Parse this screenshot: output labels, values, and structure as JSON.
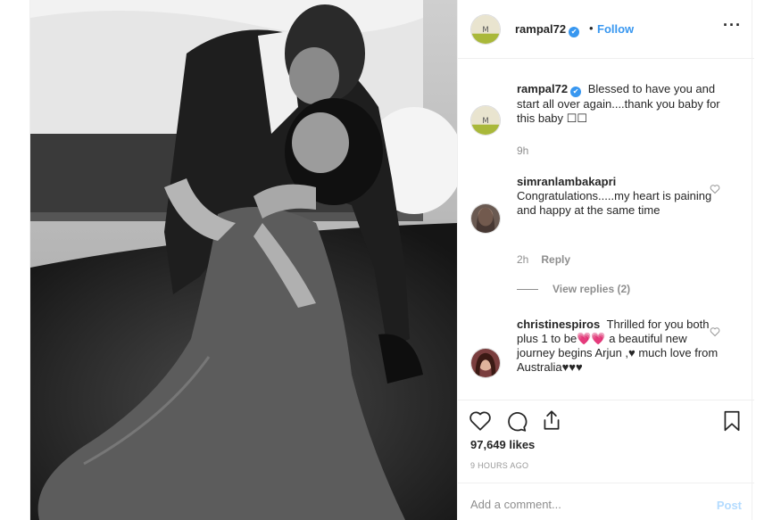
{
  "header": {
    "username": "rampal72",
    "verified_mark": "✔",
    "separator": "•",
    "follow_label": "Follow",
    "more_label": "···"
  },
  "caption": {
    "username": "rampal72",
    "verified_mark": "✔",
    "text": "Blessed to have you and start all over again....thank you baby for this baby ☐☐",
    "time": "9h"
  },
  "comments": [
    {
      "username": "simranlambakapri",
      "text": "Congratulations.....my heart is paining and happy at the same time",
      "time": "2h",
      "reply_label": "Reply",
      "view_replies": "View replies (2)"
    },
    {
      "username": "christinespiros",
      "text": "Thrilled for you both plus 1 to be💗💗 a beautiful new journey begins Arjun ,♥ much love from Australia♥♥♥"
    }
  ],
  "actions": {
    "likes": "97,649 likes",
    "timestamp": "9 HOURS AGO"
  },
  "add_comment": {
    "placeholder": "Add a comment...",
    "post_label": "Post"
  },
  "icons": {
    "like": "heart-icon",
    "comment": "comment-icon",
    "share": "share-icon",
    "save": "bookmark-icon",
    "more": "more-icon"
  },
  "colors": {
    "accent": "#3897f0",
    "muted": "#8e8e8e",
    "text": "#262626",
    "post_disabled": "#b3dbff"
  }
}
